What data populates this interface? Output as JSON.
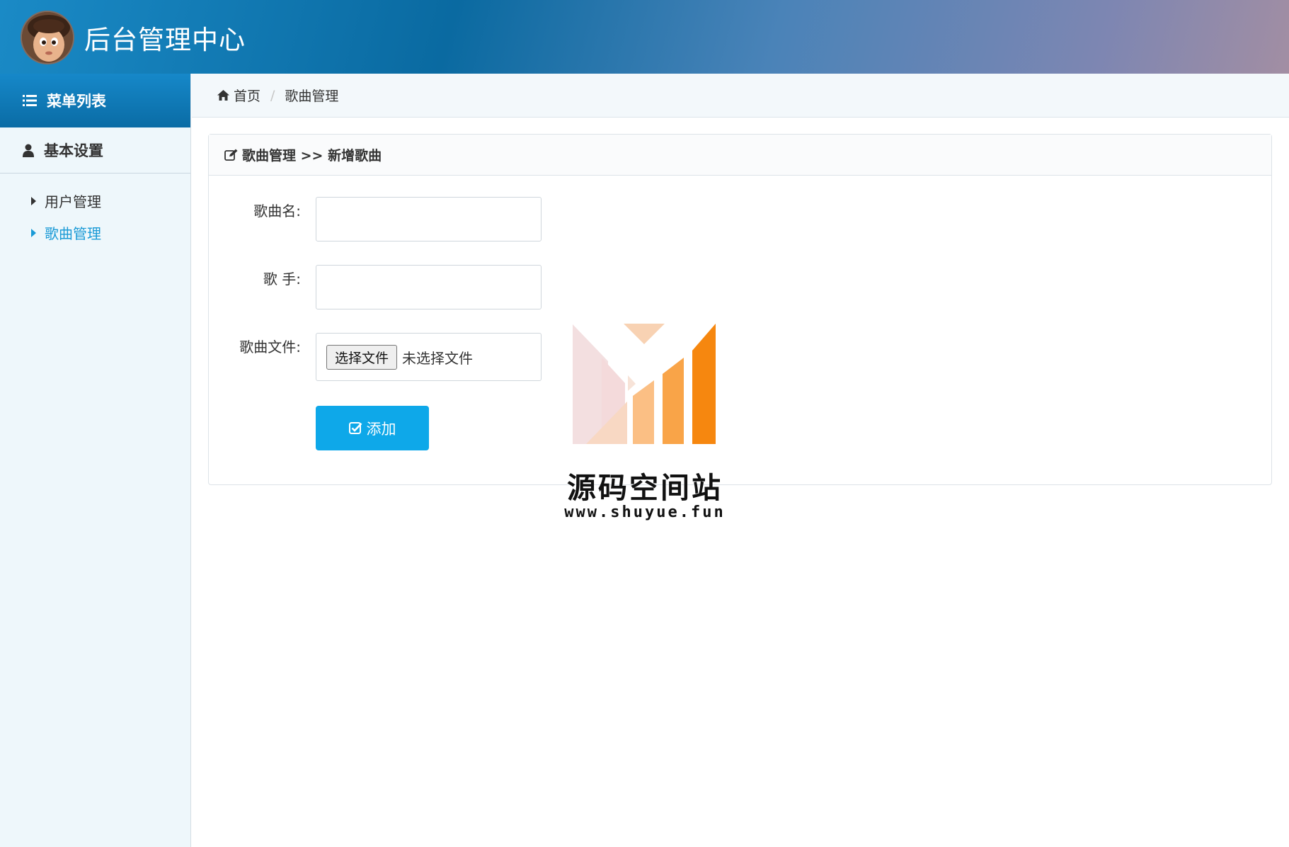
{
  "header": {
    "title": "后台管理中心"
  },
  "sidebar": {
    "menu_title": "菜单列表",
    "section_title": "基本设置",
    "items": [
      {
        "label": "用户管理",
        "active": false
      },
      {
        "label": "歌曲管理",
        "active": true
      }
    ]
  },
  "breadcrumb": {
    "home": "首页",
    "current": "歌曲管理"
  },
  "panel": {
    "heading": "歌曲管理 >> 新增歌曲"
  },
  "form": {
    "song_name_label": "歌曲名:",
    "song_name_value": "",
    "singer_label": "歌 手:",
    "singer_value": "",
    "file_label": "歌曲文件:",
    "file_button": "选择文件",
    "file_status": "未选择文件",
    "submit_label": "添加"
  },
  "watermark": {
    "title": "源码空间站",
    "url": "www.shuyue.fun"
  },
  "colors": {
    "accent": "#0ea8e9",
    "active_link": "#1a9ad6",
    "sidebar_bg": "#eef7fb",
    "header_blue": "#0a6ca5"
  }
}
